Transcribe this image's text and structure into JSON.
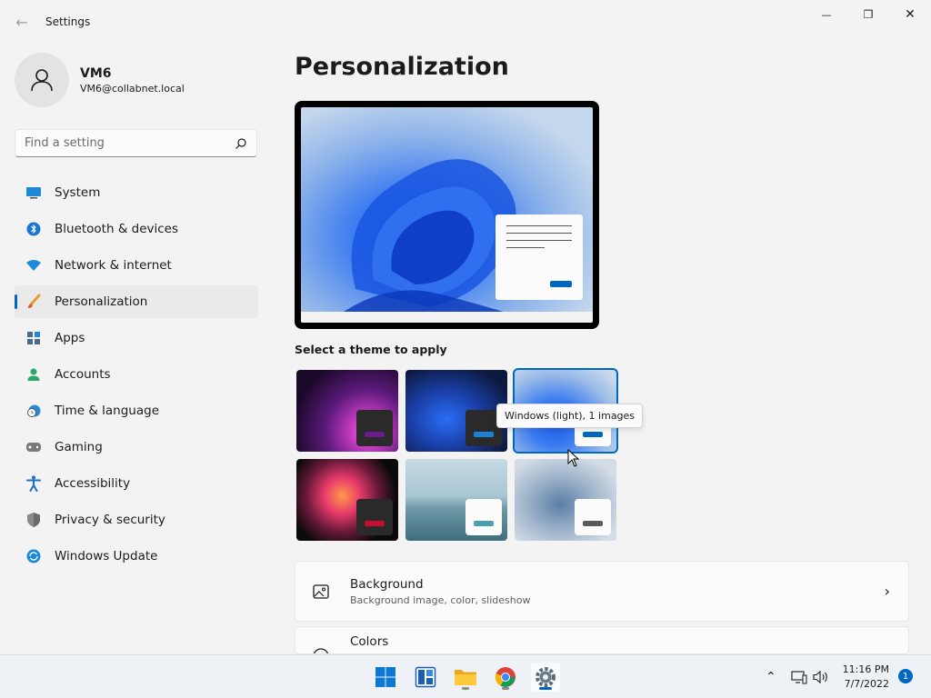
{
  "window": {
    "title": "Settings",
    "minimize_glyph": "—",
    "restore_glyph": "❐",
    "close_glyph": "✕"
  },
  "profile": {
    "name": "VM6",
    "email": "VM6@collabnet.local"
  },
  "search": {
    "placeholder": "Find a setting"
  },
  "nav": {
    "items": [
      {
        "label": "System",
        "icon": "system-icon"
      },
      {
        "label": "Bluetooth & devices",
        "icon": "bluetooth-icon"
      },
      {
        "label": "Network & internet",
        "icon": "wifi-icon"
      },
      {
        "label": "Personalization",
        "icon": "brush-icon",
        "active": true
      },
      {
        "label": "Apps",
        "icon": "apps-icon"
      },
      {
        "label": "Accounts",
        "icon": "person-icon"
      },
      {
        "label": "Time & language",
        "icon": "clock-globe-icon"
      },
      {
        "label": "Gaming",
        "icon": "gamepad-icon"
      },
      {
        "label": "Accessibility",
        "icon": "accessibility-icon"
      },
      {
        "label": "Privacy & security",
        "icon": "shield-icon"
      },
      {
        "label": "Windows Update",
        "icon": "update-icon"
      }
    ]
  },
  "main": {
    "title": "Personalization",
    "themes_label": "Select a theme to apply",
    "tooltip": "Windows (light), 1 images",
    "themes": [
      {
        "name": "theme-glow",
        "accent": "#6a1a8a"
      },
      {
        "name": "theme-windows-dark",
        "accent": "#1a7fd6"
      },
      {
        "name": "theme-windows-light",
        "accent": "#0067c0",
        "selected": true
      },
      {
        "name": "theme-captured-motion",
        "accent": "#c8102e"
      },
      {
        "name": "theme-flow",
        "accent": "#4a9fb0"
      },
      {
        "name": "theme-sunrise",
        "accent": "#5a5a5a"
      }
    ],
    "rows": [
      {
        "title": "Background",
        "subtitle": "Background image, color, slideshow",
        "icon": "image-icon"
      },
      {
        "title": "Colors",
        "subtitle": "",
        "icon": "palette-icon"
      }
    ]
  },
  "taskbar": {
    "apps": [
      "start-icon",
      "widgets-icon",
      "file-explorer-icon",
      "chrome-icon",
      "settings-icon"
    ],
    "time": "11:16 PM",
    "date": "7/7/2022",
    "notification_count": "1"
  },
  "colors": {
    "accent": "#0067c0"
  }
}
